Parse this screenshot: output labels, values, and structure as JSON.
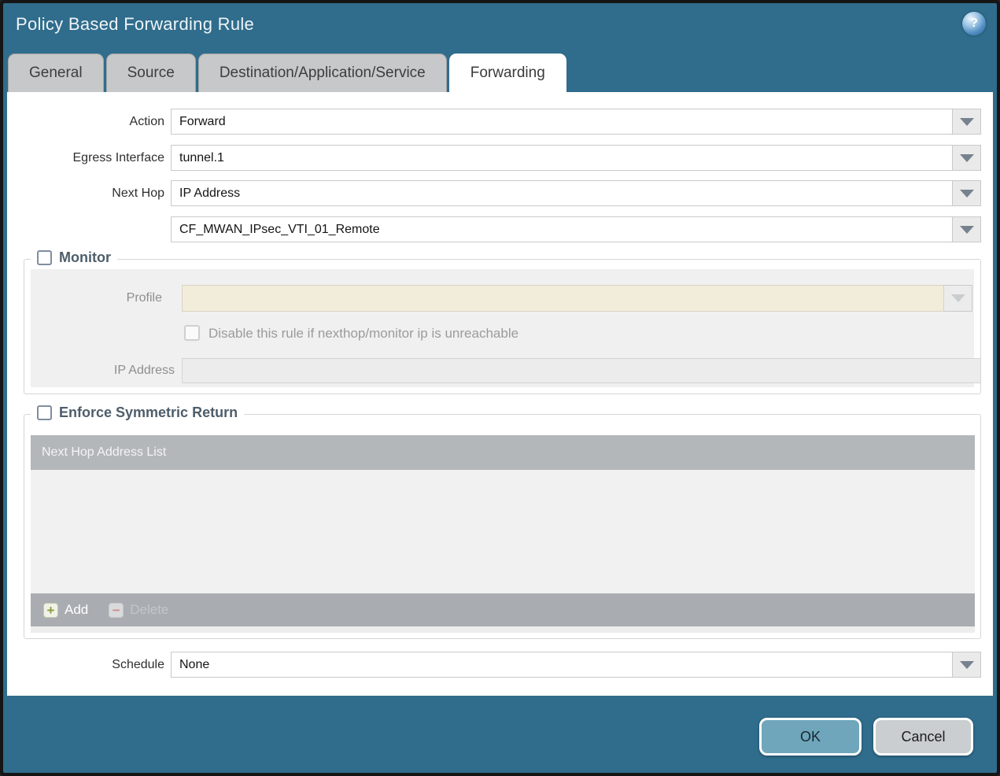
{
  "window": {
    "title": "Policy Based Forwarding Rule",
    "help_glyph": "?"
  },
  "tabs": [
    {
      "label": "General",
      "active": false
    },
    {
      "label": "Source",
      "active": false
    },
    {
      "label": "Destination/Application/Service",
      "active": false
    },
    {
      "label": "Forwarding",
      "active": true
    }
  ],
  "form": {
    "action": {
      "label": "Action",
      "value": "Forward"
    },
    "egress_interface": {
      "label": "Egress Interface",
      "value": "tunnel.1"
    },
    "next_hop": {
      "label": "Next Hop",
      "value": "IP Address"
    },
    "next_hop_address": {
      "value": "CF_MWAN_IPsec_VTI_01_Remote"
    },
    "monitor": {
      "legend": "Monitor",
      "checked": false,
      "profile_label": "Profile",
      "profile_value": "",
      "disable_rule_label": "Disable this rule if nexthop/monitor ip is unreachable",
      "disable_rule_checked": false,
      "ip_address_label": "IP Address",
      "ip_address_value": ""
    },
    "enforce_symmetric_return": {
      "legend": "Enforce Symmetric Return",
      "checked": false,
      "table_header": "Next Hop Address List",
      "rows": [],
      "add_label": "Add",
      "delete_label": "Delete",
      "delete_enabled": false
    },
    "schedule": {
      "label": "Schedule",
      "value": "None"
    }
  },
  "footer": {
    "ok_label": "OK",
    "cancel_label": "Cancel"
  },
  "icons": {
    "add_glyph": "+",
    "delete_glyph": "−"
  },
  "colors": {
    "titlebar": "#306c8c",
    "tab_inactive": "#c7c8c9",
    "tab_active": "#ffffff",
    "disabled_field_beige": "#f2ecdb",
    "panel_gray": "#f0f0f0",
    "table_header": "#b3b7ba",
    "table_footer": "#a9adb1",
    "ok_button": "#6fa6bb",
    "cancel_button": "#caced1",
    "add_plus": "#8a9a3c"
  }
}
